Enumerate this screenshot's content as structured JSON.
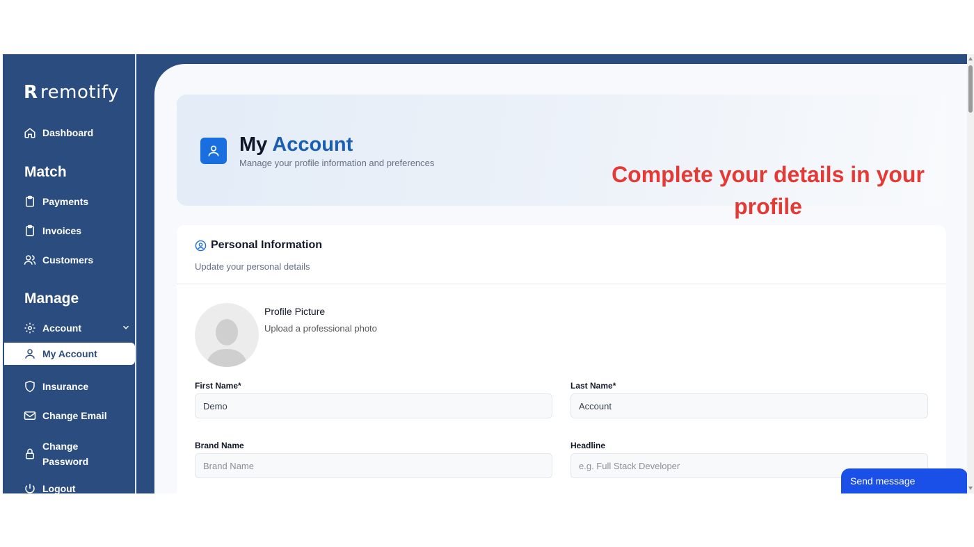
{
  "sidebar": {
    "logo": "remotify",
    "dashboard": "Dashboard",
    "section_match": "Match",
    "payments": "Payments",
    "invoices": "Invoices",
    "customers": "Customers",
    "section_manage": "Manage",
    "account": "Account",
    "my_account": "My Account",
    "insurance": "Insurance",
    "change_email": "Change Email",
    "change_password_line1": "Change",
    "change_password_line2": "Password",
    "logout": "Logout"
  },
  "header": {
    "title_part1": "My",
    "title_part2": "Account",
    "subtitle": "Manage your profile information and preferences"
  },
  "callout": {
    "line1": "Complete your details in your",
    "line2": "profile"
  },
  "personal_info": {
    "title": "Personal Information",
    "subtitle": "Update your personal details",
    "profile_picture_title": "Profile Picture",
    "profile_picture_sub": "Upload a professional photo"
  },
  "form": {
    "first_name_label": "First Name*",
    "first_name_value": "Demo",
    "last_name_label": "Last Name*",
    "last_name_value": "Account",
    "brand_name_label": "Brand Name",
    "brand_name_placeholder": "Brand Name",
    "headline_label": "Headline",
    "headline_placeholder": "e.g. Full Stack Developer"
  },
  "chat": {
    "send_label": "Send message"
  },
  "colors": {
    "sidebar": "#2b4c7e",
    "accent": "#1a6fe0",
    "callout": "#e53935",
    "chat": "#1a4fe8"
  }
}
